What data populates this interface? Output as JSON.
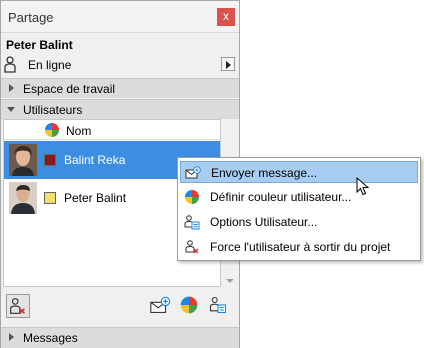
{
  "window": {
    "title": "Partage",
    "close_glyph": "x"
  },
  "user": {
    "name": "Peter Balint",
    "status": "En ligne"
  },
  "sections": {
    "workspace": "Espace de travail",
    "users": "Utilisateurs",
    "messages": "Messages"
  },
  "user_list": {
    "column_header": "Nom",
    "rows": [
      {
        "name": "Balint Reka",
        "color": "#8b1a1a",
        "selected": true
      },
      {
        "name": "Peter Balint",
        "color": "#f2e06a",
        "selected": false
      }
    ]
  },
  "context_menu": {
    "items": [
      {
        "label": "Envoyer message...",
        "icon": "send-message-icon"
      },
      {
        "label": "Définir couleur utilisateur...",
        "icon": "color-wheel-icon"
      },
      {
        "label": "Options Utilisateur...",
        "icon": "user-options-icon"
      },
      {
        "label": "Force l'utilisateur à sortir du projet",
        "icon": "kick-user-icon"
      }
    ]
  },
  "colors": {
    "selection": "#3c8ee3",
    "menu_hover": "#a7cdf3",
    "close_button": "#d9534f"
  }
}
